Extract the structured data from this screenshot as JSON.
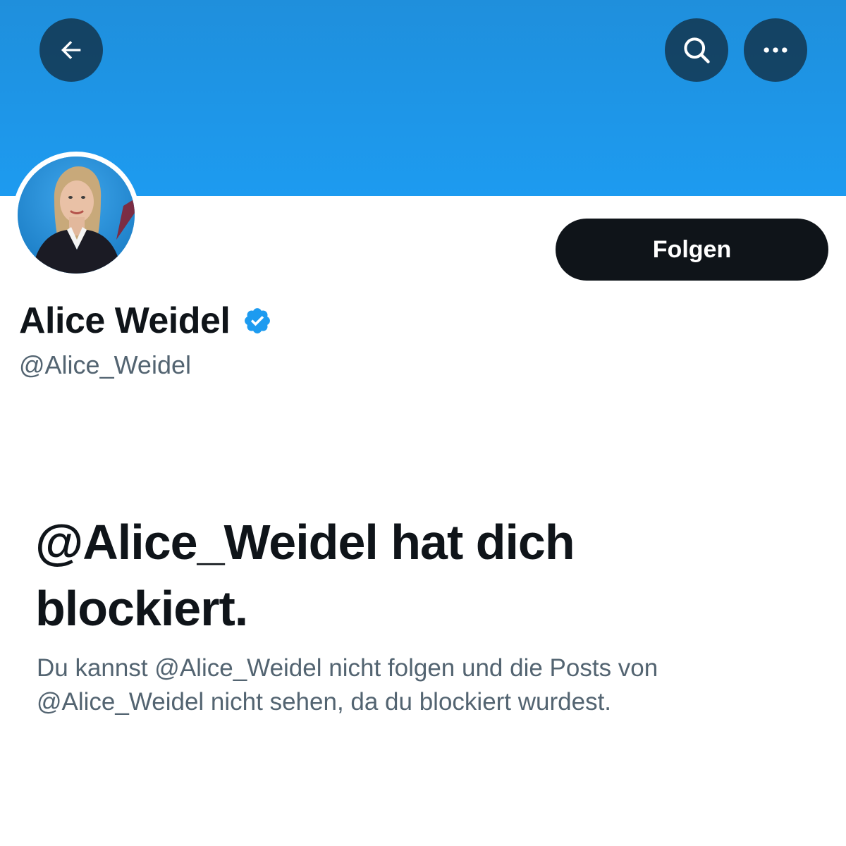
{
  "header": {
    "back_icon": "arrow-left-icon",
    "search_icon": "search-icon",
    "more_icon": "more-horizontal-icon",
    "banner_color": "#1d9bf0"
  },
  "profile": {
    "display_name": "Alice Weidel",
    "verified": true,
    "verified_icon": "verified-badge-icon",
    "verified_color": "#1d9bf0",
    "handle": "@Alice_Weidel",
    "follow_label": "Folgen"
  },
  "blocked": {
    "title": "@Alice_Weidel hat dich blockiert.",
    "description": "Du kannst @Alice_Weidel nicht folgen und die Posts von @Alice_Weidel nicht sehen, da du blockiert wurdest."
  }
}
